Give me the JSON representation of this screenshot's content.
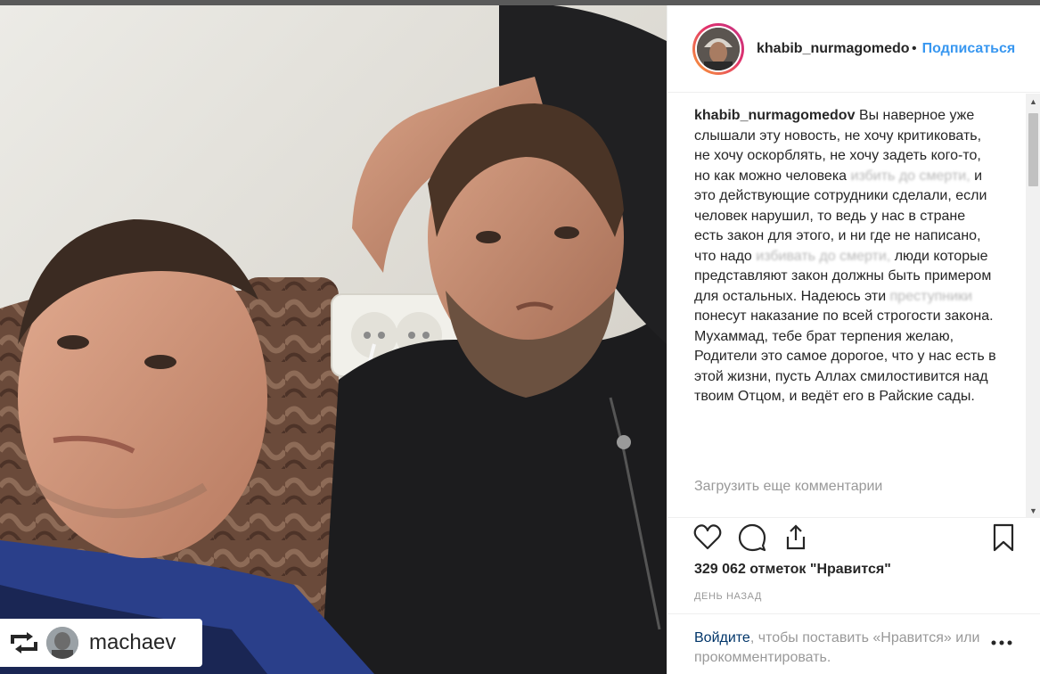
{
  "header": {
    "username": "khabib_nurmagomedov",
    "dot": "•",
    "follow_label": "Подписаться"
  },
  "caption": {
    "username": "khabib_nurmagomedov",
    "part1": "Вы наверное уже слышали эту новость, не хочу критиковать, не хочу оскорблять, не хочу задеть кого-то, но как можно человека",
    "blur1": "избить до смерти,",
    "part2": "и это действующие сотрудники сделали, если человек нарушил, то ведь у нас в стране есть закон для этого, и ни где не написано, что надо",
    "blur2": "избивать до смерти,",
    "part3": "люди которые представляют закон должны быть примером для остальных. Надеюсь эти",
    "blur3": "преступники",
    "part4": "понесут наказание по всей строгости закона. Мухаммад, тебе брат терпения желаю, Родители это самое дорогое, что у нас есть в этой жизни, пусть Аллах смилостивится над твоим Отцом, и ведёт его в Райские сады."
  },
  "load_more": "Загрузить еще комментарии",
  "scrollbar": {
    "up_arrow": "▲",
    "down_arrow": "▼"
  },
  "likes": "329 062 отметок \"Нравится\"",
  "time_ago": "ДЕНЬ НАЗАД",
  "login": {
    "link": "Войдите",
    "rest": ", чтобы поставить «Нравится» или прокомментировать."
  },
  "repost": {
    "username": "machaev"
  },
  "icons": {
    "like": "heart-icon",
    "comment": "comment-bubble-icon",
    "share": "share-icon",
    "save": "bookmark-icon",
    "repost": "repost-icon",
    "more": "more-dots-icon"
  },
  "colors": {
    "follow_blue": "#3897f0",
    "login_link": "#003569",
    "muted_text": "#999999"
  }
}
